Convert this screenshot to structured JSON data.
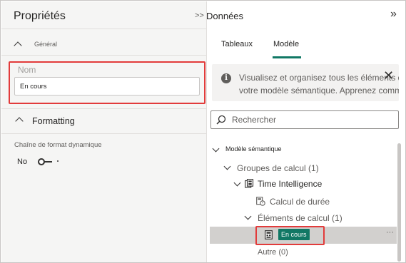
{
  "left_pane": {
    "title": "Propriétés",
    "collapse_label": ">>",
    "general_section": {
      "label": "Général"
    },
    "name_field": {
      "label": "Nom",
      "value": "En cours"
    },
    "formatting_section": {
      "label": "Formatting"
    },
    "dynamic_format": {
      "label": "Chaîne de format dynamique",
      "toggle_value": "No"
    }
  },
  "right_pane": {
    "title": "Données",
    "expand_icon": "double-chevron-right",
    "tabs": [
      {
        "label": "Tableaux",
        "active": false
      },
      {
        "label": "Modèle",
        "active": true
      }
    ],
    "info": {
      "line1": "Visualisez et organisez tous les éléments dans",
      "line2": "votre modèle sémantique. Apprenez comm"
    },
    "search": {
      "placeholder": "Rechercher"
    },
    "tree": {
      "root": "Modèle sémantique",
      "calc_groups": "Groupes de calcul (1)",
      "time_intelligence": "Time Intelligence",
      "duration_calc": "Calcul de durée",
      "calc_items": "Éléments de calcul (1)",
      "selected_item": "En cours",
      "other": "Autre (0)",
      "more_icon": "ellipsis"
    }
  },
  "colors": {
    "accent": "#117865",
    "highlight": "#e23b3b",
    "selected_row": "#d2d0ce"
  }
}
